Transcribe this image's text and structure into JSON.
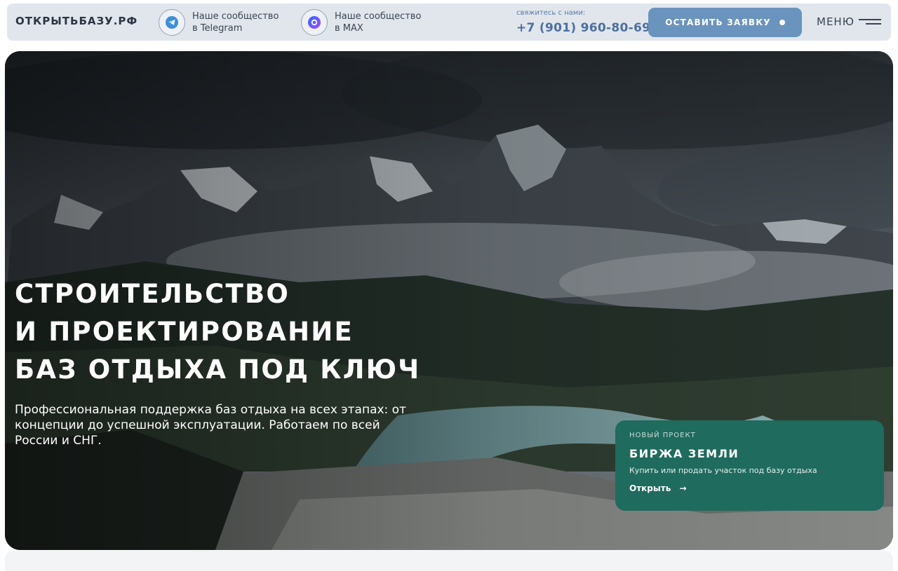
{
  "header": {
    "logo": "ОТКРЫТЬБАЗУ.РФ",
    "telegram": {
      "line1": "Наше сообщество",
      "line2": "в Telegram"
    },
    "max": {
      "line1": "Наше сообщество",
      "line2": "в MAX"
    },
    "contact_label": "свяжитесь с нами:",
    "phone": "+7 (901) 960-80-69",
    "cta_label": "ОСТАВИТЬ ЗАЯВКУ",
    "menu_label": "МЕНЮ"
  },
  "hero": {
    "title_line1": "СТРОИТЕЛЬСТВО",
    "title_line2": "И ПРОЕКТИРОВАНИЕ",
    "title_line3": "БАЗ ОТДЫХА ПОД КЛЮЧ",
    "subtitle": "Профессиональная поддержка баз отдыха на всех этапах: от концепции до успешной эксплуатации. Работаем по всей России и СНГ."
  },
  "card": {
    "kicker": "НОВЫЙ ПРОЕКТ",
    "title": "БИРЖА ЗЕМЛИ",
    "description": "Купить или продать участок под базу отдыха",
    "link_label": "Открыть",
    "link_arrow": "→"
  },
  "colors": {
    "header_bg": "#e1e6ed",
    "cta_bg": "#6a94bd",
    "phone": "#4c6fa0",
    "card_bg": "#1f6b5e"
  },
  "icons": {
    "telegram": "telegram-icon",
    "max": "max-icon",
    "menu": "menu-icon",
    "cta_dot": "dot-icon"
  }
}
